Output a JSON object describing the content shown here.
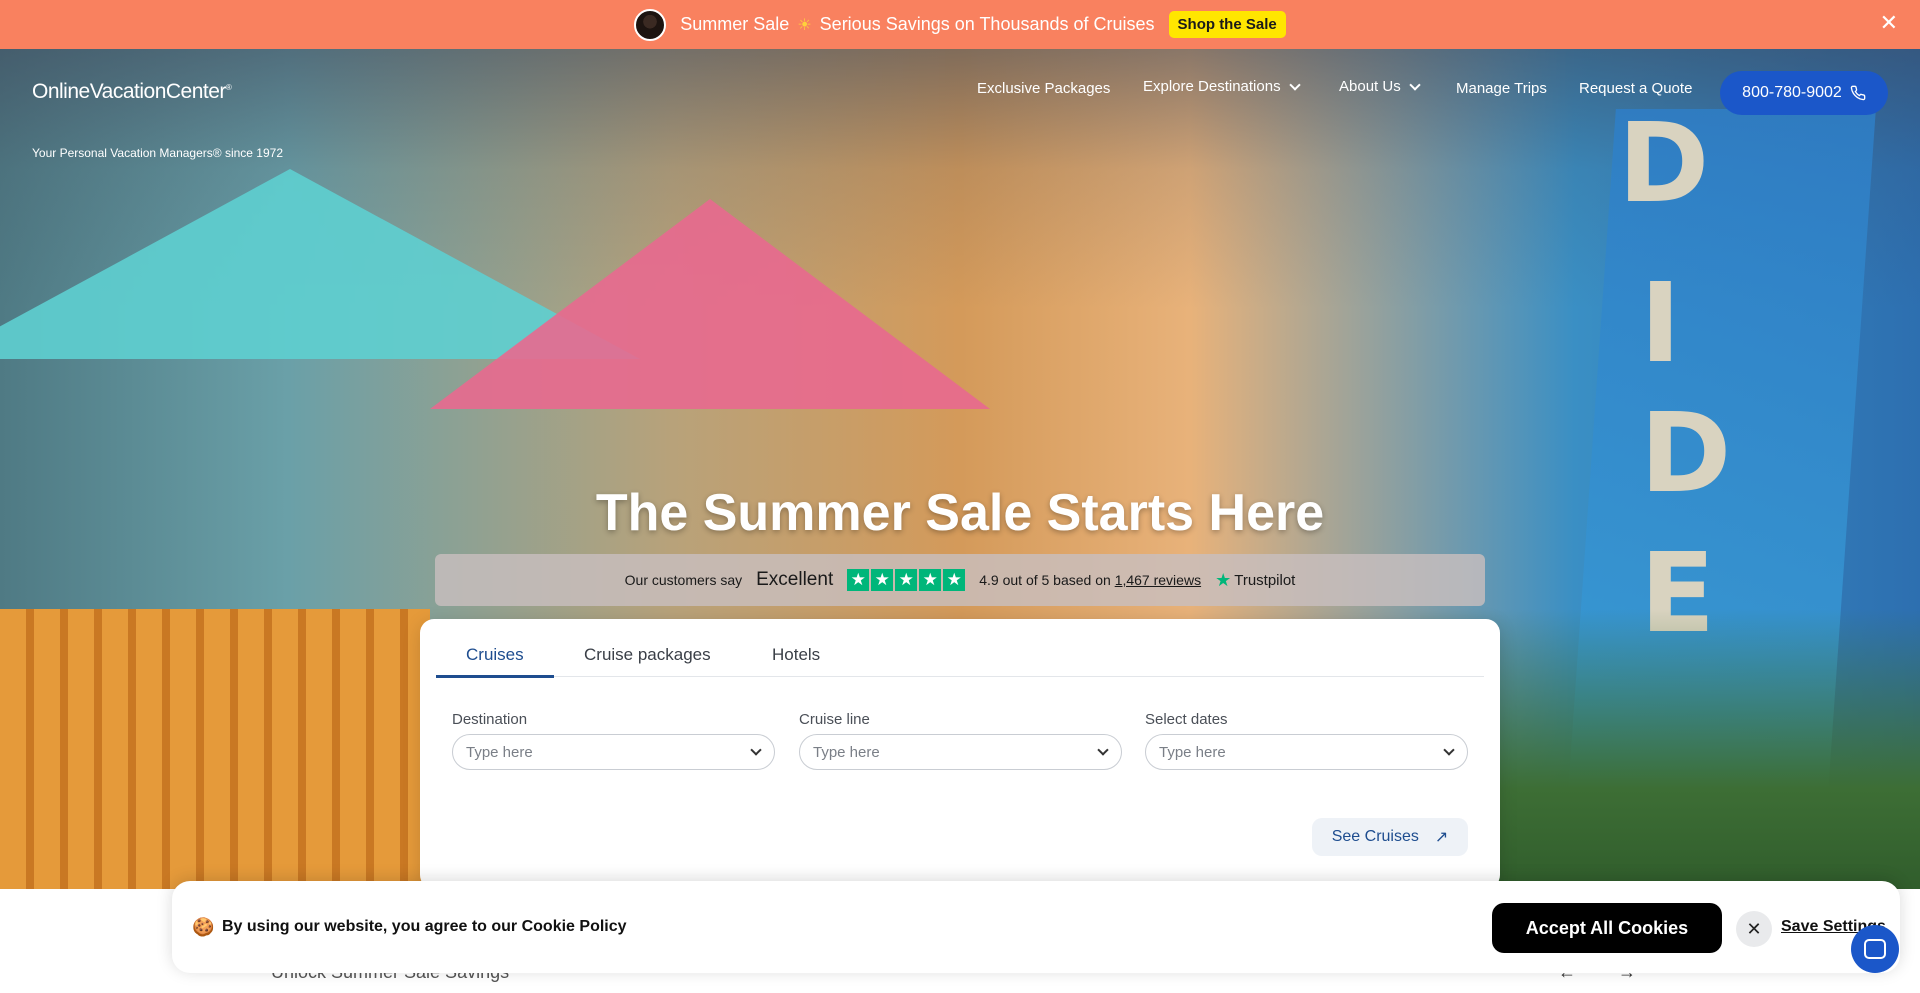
{
  "promo": {
    "text_1": "Summer Sale",
    "text_2": "Serious Savings on Thousands of Cruises",
    "cta": "Shop the Sale",
    "close": "✕"
  },
  "header": {
    "logo": "OnlineVacationCenter",
    "tagline": "Your Personal Vacation Managers® since 1972",
    "nav": [
      "Exclusive Packages",
      "Explore Destinations",
      "About Us",
      "Manage Trips",
      "Request a Quote"
    ],
    "phone": "800-780-9002"
  },
  "hero": {
    "headline": "The Summer Sale Starts Here",
    "sign_letters": [
      "D",
      "I",
      "D",
      "E"
    ]
  },
  "trust": {
    "prefix": "Our customers say",
    "rating_word": "Excellent",
    "summary_1": "4.9 out of 5 based on",
    "reviews_link": "1,467 reviews",
    "brand": "Trustpilot",
    "stars": 5
  },
  "search": {
    "tabs": [
      "Cruises",
      "Cruise packages",
      "Hotels"
    ],
    "active_tab": "Cruises",
    "fields": [
      {
        "label": "Destination",
        "placeholder": "Type here"
      },
      {
        "label": "Cruise line",
        "placeholder": "Type here"
      },
      {
        "label": "Select dates",
        "placeholder": "Type here"
      }
    ],
    "submit": "See Cruises"
  },
  "below": {
    "heading": "Unlock Summer Sale Savings"
  },
  "cookie": {
    "text": "By using our website, you agree to our Cookie Policy",
    "accept": "Accept All Cookies",
    "save": "Save Settings"
  },
  "colors": {
    "promo_bg": "#f9815f",
    "promo_cta": "#ffe600",
    "brand_blue": "#1b57c9",
    "tab_active": "#1e4d8f",
    "trustpilot_green": "#00b67a"
  }
}
